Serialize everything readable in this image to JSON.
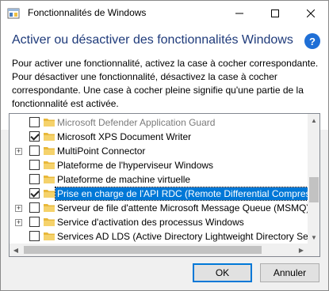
{
  "window": {
    "title": "Fonctionnalités de Windows"
  },
  "header": {
    "heading": "Activer ou désactiver des fonctionnalités Windows",
    "help": "?",
    "description": [
      "Pour activer une fonctionnalité, activez la case à cocher correspondante.",
      "Pour désactiver une fonctionnalité, désactivez la case à cocher",
      "correspondante. Une case à cocher pleine signifie qu'une partie de la",
      "fonctionnalité est activée."
    ]
  },
  "features": [
    {
      "label": "Microsoft Defender Application Guard",
      "checked": false,
      "expandable": false,
      "disabled": true,
      "selected": false
    },
    {
      "label": "Microsoft XPS Document Writer",
      "checked": true,
      "expandable": false,
      "disabled": false,
      "selected": false
    },
    {
      "label": "MultiPoint Connector",
      "checked": false,
      "expandable": true,
      "disabled": false,
      "selected": false
    },
    {
      "label": "Plateforme de l'hyperviseur Windows",
      "checked": false,
      "expandable": false,
      "disabled": false,
      "selected": false
    },
    {
      "label": "Plateforme de machine virtuelle",
      "checked": false,
      "expandable": false,
      "disabled": false,
      "selected": false
    },
    {
      "label": "Prise en charge de l'API RDC (Remote Differential Compressi",
      "checked": true,
      "expandable": false,
      "disabled": false,
      "selected": true
    },
    {
      "label": "Serveur de file d'attente Microsoft Message Queue (MSMQ)",
      "checked": false,
      "expandable": true,
      "disabled": false,
      "selected": false
    },
    {
      "label": "Service d'activation des processus Windows",
      "checked": false,
      "expandable": true,
      "disabled": false,
      "selected": false
    },
    {
      "label": "Services AD LDS (Active Directory Lightweight Directory Serv",
      "checked": false,
      "expandable": false,
      "disabled": false,
      "selected": false
    }
  ],
  "buttons": {
    "ok": "OK",
    "cancel": "Annuler"
  },
  "colors": {
    "accent": "#0078d7",
    "folder": "#f5d26b",
    "heading": "#1e3a7a"
  }
}
